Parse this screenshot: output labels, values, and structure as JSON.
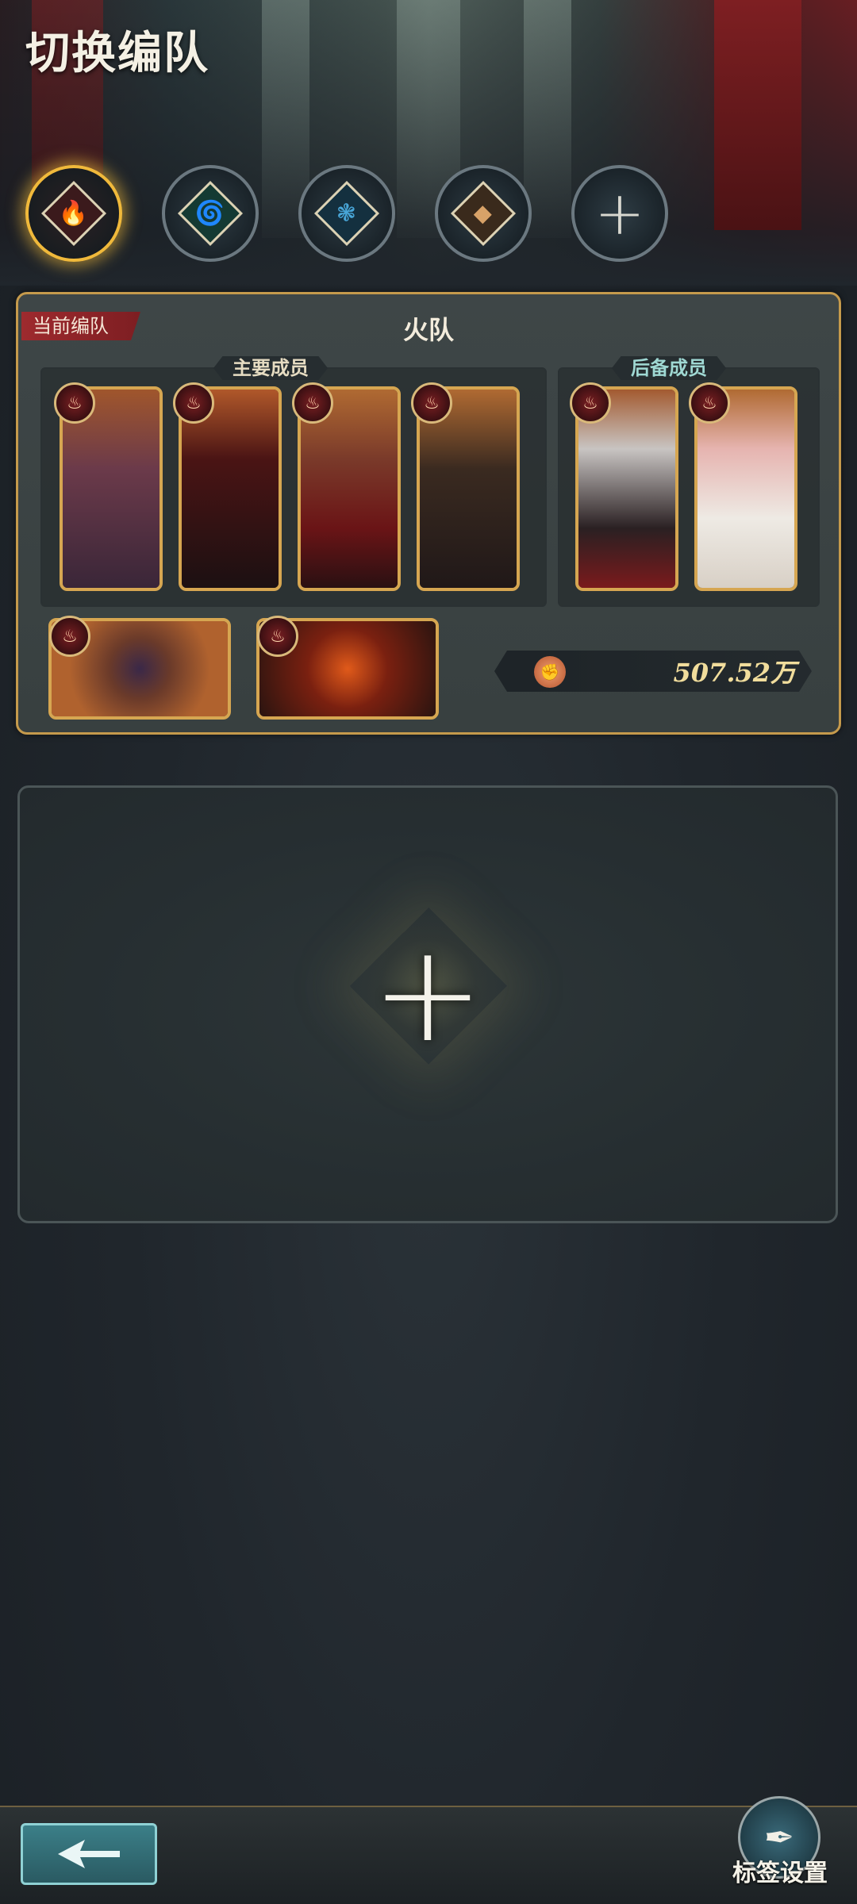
{
  "header": {
    "title": "切换编队"
  },
  "tabs": [
    {
      "icon": "fire-element-icon",
      "color": "#c8464a",
      "active": true
    },
    {
      "icon": "wind-element-icon",
      "color": "#3fc69a",
      "active": false
    },
    {
      "icon": "water-element-icon",
      "color": "#48a6d8",
      "active": false
    },
    {
      "icon": "earth-element-icon",
      "color": "#d8a268",
      "active": false
    },
    {
      "icon": "add-team-icon",
      "active": false
    }
  ],
  "current_team": {
    "tag": "当前编队",
    "name": "火队",
    "main_label": "主要成员",
    "reserve_label": "后备成员",
    "main_members": [
      {
        "element": "fire",
        "desc": "brown-haired man in purple coat"
      },
      {
        "element": "fire",
        "desc": "red-haired man in black armor"
      },
      {
        "element": "fire",
        "desc": "girl in red hood"
      },
      {
        "element": "fire",
        "desc": "dark-haired woman in black"
      }
    ],
    "reserve_members": [
      {
        "element": "fire",
        "desc": "silver-haired woman"
      },
      {
        "element": "fire",
        "desc": "pink-haired girl in white dress"
      }
    ],
    "support_cards": [
      {
        "element": "fire",
        "desc": "dark orb artifact"
      },
      {
        "element": "fire",
        "desc": "lava dragon"
      }
    ],
    "power_value": "507.52万"
  },
  "bottom": {
    "label_settings": "标签设置"
  }
}
